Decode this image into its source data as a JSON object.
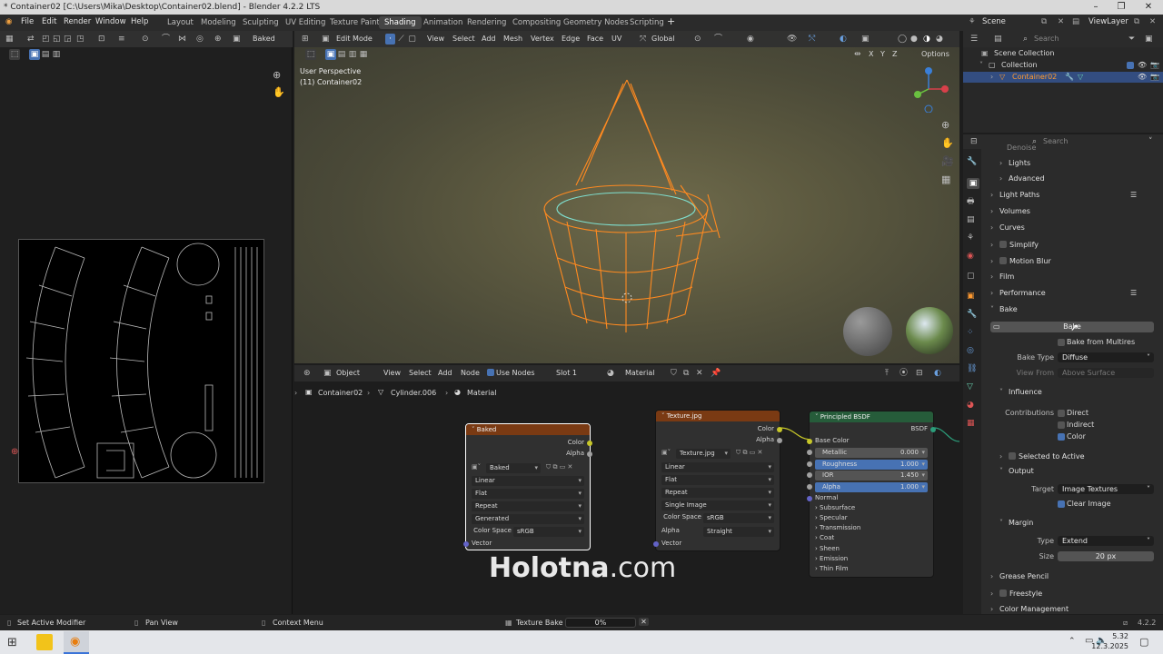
{
  "title": "* Container02 [C:\\Users\\Mika\\Desktop\\Container02.blend] - Blender 4.2.2 LTS",
  "menu": [
    "File",
    "Edit",
    "Render",
    "Window",
    "Help"
  ],
  "workspaces": [
    "Layout",
    "Modeling",
    "Sculpting",
    "UV Editing",
    "Texture Paint",
    "Shading",
    "Animation",
    "Rendering",
    "Compositing",
    "Geometry Nodes",
    "Scripting"
  ],
  "active_workspace": "Shading",
  "scene": "Scene",
  "view_layer": "ViewLayer",
  "uv_editor": {
    "image_name": "Baked"
  },
  "viewport": {
    "mode": "Edit Mode",
    "menu": [
      "View",
      "Select",
      "Add",
      "Mesh",
      "Vertex",
      "Edge",
      "Face",
      "UV"
    ],
    "orientation": "Global",
    "options": "Options",
    "axes": [
      "X",
      "Y",
      "Z"
    ],
    "overlay_line1": "User Perspective",
    "overlay_line2": "(11) Container02"
  },
  "node_editor": {
    "type": "Object",
    "menu": [
      "View",
      "Select",
      "Add",
      "Node"
    ],
    "use_nodes": "Use Nodes",
    "slot": "Slot 1",
    "material": "Material",
    "breadcrumb": [
      "Container02",
      "Cylinder.006",
      "Material"
    ],
    "baked_node": {
      "title": "Baked",
      "out_color": "Color",
      "out_alpha": "Alpha",
      "image": "Baked",
      "interp": "Linear",
      "projection": "Flat",
      "extension": "Repeat",
      "source": "Generated",
      "cs_label": "Color Space",
      "cs_value": "sRGB",
      "vector": "Vector"
    },
    "texture_node": {
      "title": "Texture.jpg",
      "out_color": "Color",
      "out_alpha": "Alpha",
      "image": "Texture.jpg",
      "interp": "Linear",
      "projection": "Flat",
      "extension": "Repeat",
      "source": "Single Image",
      "cs_label": "Color Space",
      "cs_value": "sRGB",
      "alpha_label": "Alpha",
      "alpha_value": "Straight",
      "vector": "Vector"
    },
    "bsdf_node": {
      "title": "Principled BSDF",
      "out": "BSDF",
      "base_color": "Base Color",
      "metallic_label": "Metallic",
      "metallic": "0.000",
      "roughness_label": "Roughness",
      "roughness": "1.000",
      "ior_label": "IOR",
      "ior": "1.450",
      "alpha_label": "Alpha",
      "alpha": "1.000",
      "normal": "Normal",
      "panels": [
        "Subsurface",
        "Specular",
        "Transmission",
        "Coat",
        "Sheen",
        "Emission",
        "Thin Film"
      ]
    }
  },
  "watermark": {
    "bold": "Holotna",
    "rest": ".com"
  },
  "outliner": {
    "search_placeholder": "Search",
    "root": "Scene Collection",
    "collection": "Collection",
    "object": "Container02"
  },
  "properties": {
    "search_placeholder": "Search",
    "top_cut": "Denoise",
    "sections_top": [
      "Lights",
      "Advanced"
    ],
    "sections": [
      "Light Paths",
      "Volumes",
      "Curves",
      "Simplify",
      "Motion Blur",
      "Film",
      "Performance",
      "Bake"
    ],
    "bake_button": "Bake",
    "bake_from_multires": "Bake from Multires",
    "bake_type_label": "Bake Type",
    "bake_type": "Diffuse",
    "view_from_label": "View From",
    "view_from": "Above Surface",
    "influence": "Influence",
    "contributions": "Contributions",
    "direct": "Direct",
    "indirect": "Indirect",
    "color": "Color",
    "selected_to_active": "Selected to Active",
    "output": "Output",
    "target_label": "Target",
    "target": "Image Textures",
    "clear_image": "Clear Image",
    "margin": "Margin",
    "type_label": "Type",
    "type": "Extend",
    "size_label": "Size",
    "size": "20 px",
    "sections_bottom": [
      "Grease Pencil",
      "Freestyle",
      "Color Management"
    ]
  },
  "status": {
    "left": "Set Active Modifier",
    "mid": "Pan View",
    "right": "Context Menu",
    "job": "Texture Bake",
    "progress_text": "0%",
    "progress": 0,
    "version": "4.2.2"
  },
  "taskbar": {
    "time": "5.32",
    "date": "12.3.2025"
  }
}
